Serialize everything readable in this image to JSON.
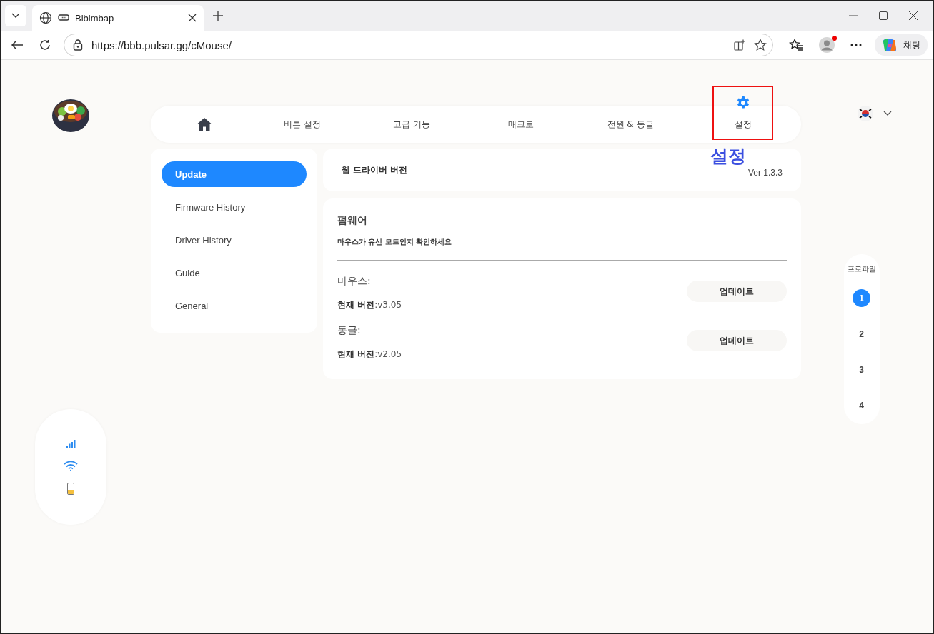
{
  "browser": {
    "tab_title": "Bibimbap",
    "url": "https://bbb.pulsar.gg/cMouse/",
    "copilot_label": "채팅",
    "profile_notification": true
  },
  "nav": [
    {
      "kind": "home",
      "selected": false
    },
    {
      "kind": "text",
      "label": "버튼 설정",
      "selected": false
    },
    {
      "kind": "text",
      "label": "고급 기능",
      "selected": false
    },
    {
      "kind": "text",
      "label": "매크로",
      "selected": false
    },
    {
      "kind": "text",
      "label": "전원 & 동글",
      "selected": false
    },
    {
      "kind": "settings",
      "label": "설정",
      "selected": true
    }
  ],
  "annotation": {
    "label": "설정"
  },
  "sidebar": {
    "items": [
      {
        "label": "Update",
        "selected": true
      },
      {
        "label": "Firmware History",
        "selected": false
      },
      {
        "label": "Driver History",
        "selected": false
      },
      {
        "label": "Guide",
        "selected": false
      },
      {
        "label": "General",
        "selected": false
      }
    ]
  },
  "web_driver": {
    "title": "웹 드라이버 버전",
    "version": "Ver 1.3.3"
  },
  "firmware": {
    "title": "펌웨어",
    "note": "마우스가 유선 모드인지 확인하세요",
    "devices": [
      {
        "name": "마우스:",
        "version_label": "현재 버전",
        "version": ":v3.05",
        "button": "업데이트"
      },
      {
        "name": "동글:",
        "version_label": "현재 버전",
        "version": ":v2.05",
        "button": "업데이트"
      }
    ]
  },
  "status": {
    "battery": {
      "level": 0.4
    }
  },
  "profiles": {
    "title": "프로파일",
    "items": [
      {
        "label": "1",
        "selected": true
      },
      {
        "label": "2",
        "selected": false
      },
      {
        "label": "3",
        "selected": false
      },
      {
        "label": "4",
        "selected": false
      }
    ]
  }
}
